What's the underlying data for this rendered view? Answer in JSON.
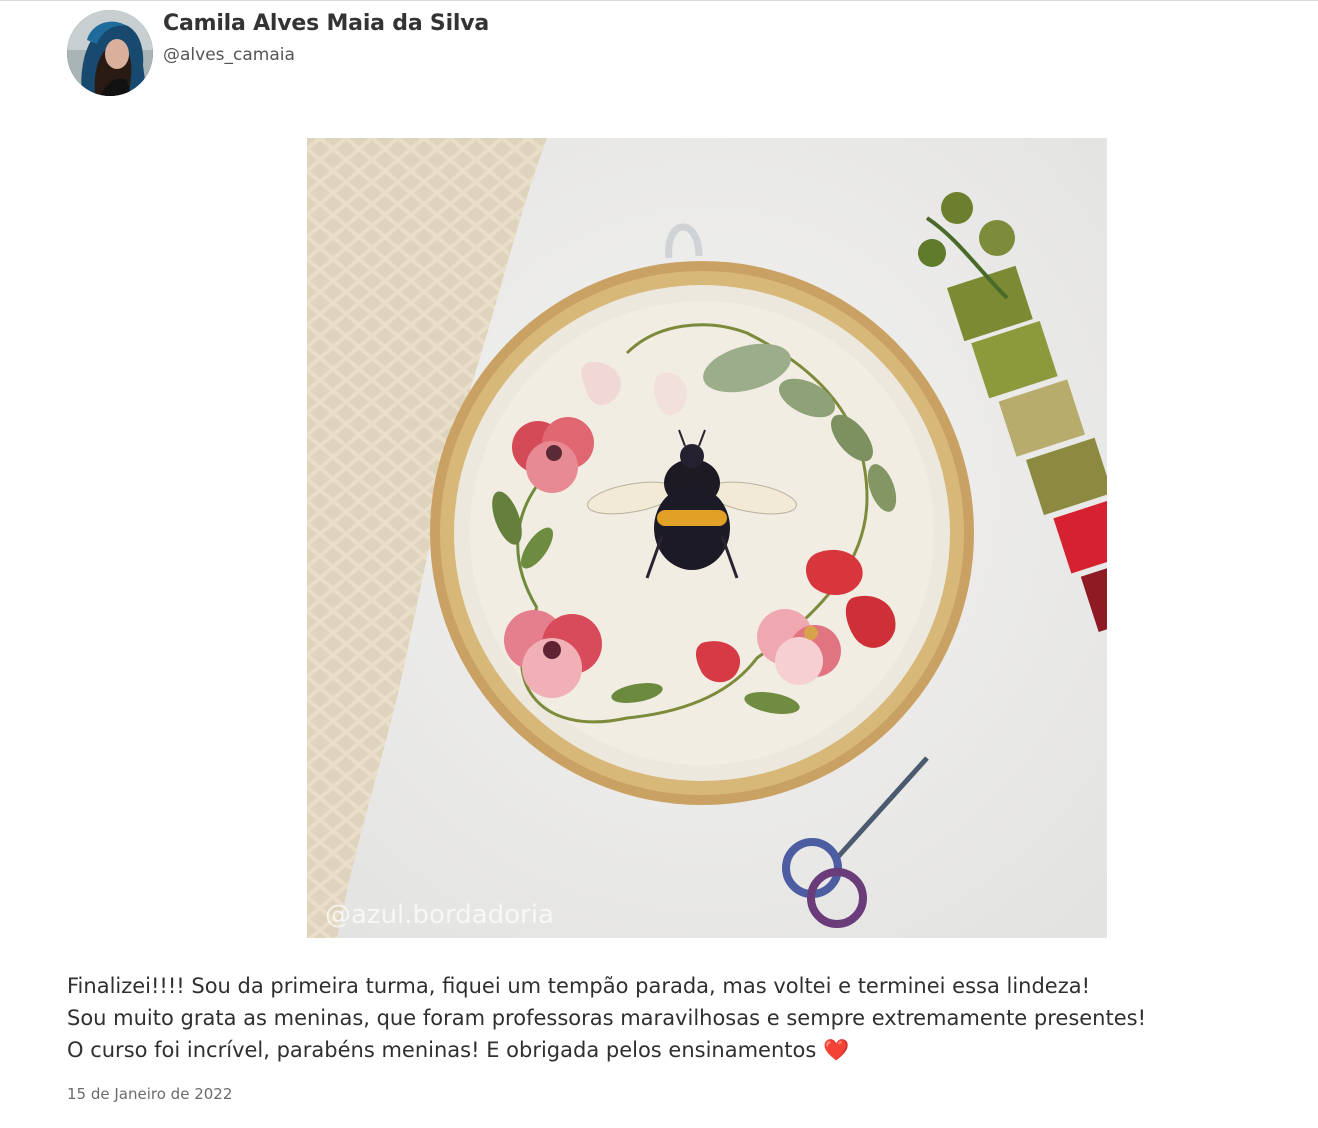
{
  "post": {
    "author_name": "Camila Alves Maia da Silva",
    "author_handle": "@alves_camaia",
    "image_watermark": "@azul.bordadoria",
    "caption_lines": [
      "Finalizei!!!! Sou da primeira turma, fiquei um tempão parada, mas voltei e terminei essa lindeza!",
      "Sou muito grata as meninas, que foram professoras maravilhosas e sempre extremamente presentes!",
      "O curso foi incrível, parabéns meninas! E obrigada pelos ensinamentos"
    ],
    "caption_emoji": "❤️",
    "date": "15 de Janeiro de 2022"
  }
}
